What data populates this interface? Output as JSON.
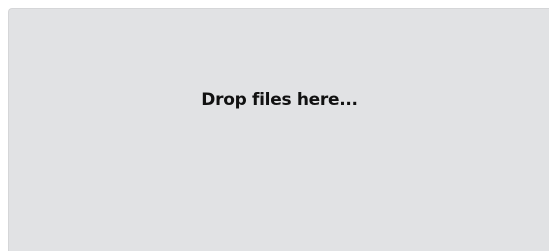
{
  "dropzone": {
    "label": "Drop files here...",
    "background_color": "#e1e2e4",
    "text_color": "#111111"
  }
}
